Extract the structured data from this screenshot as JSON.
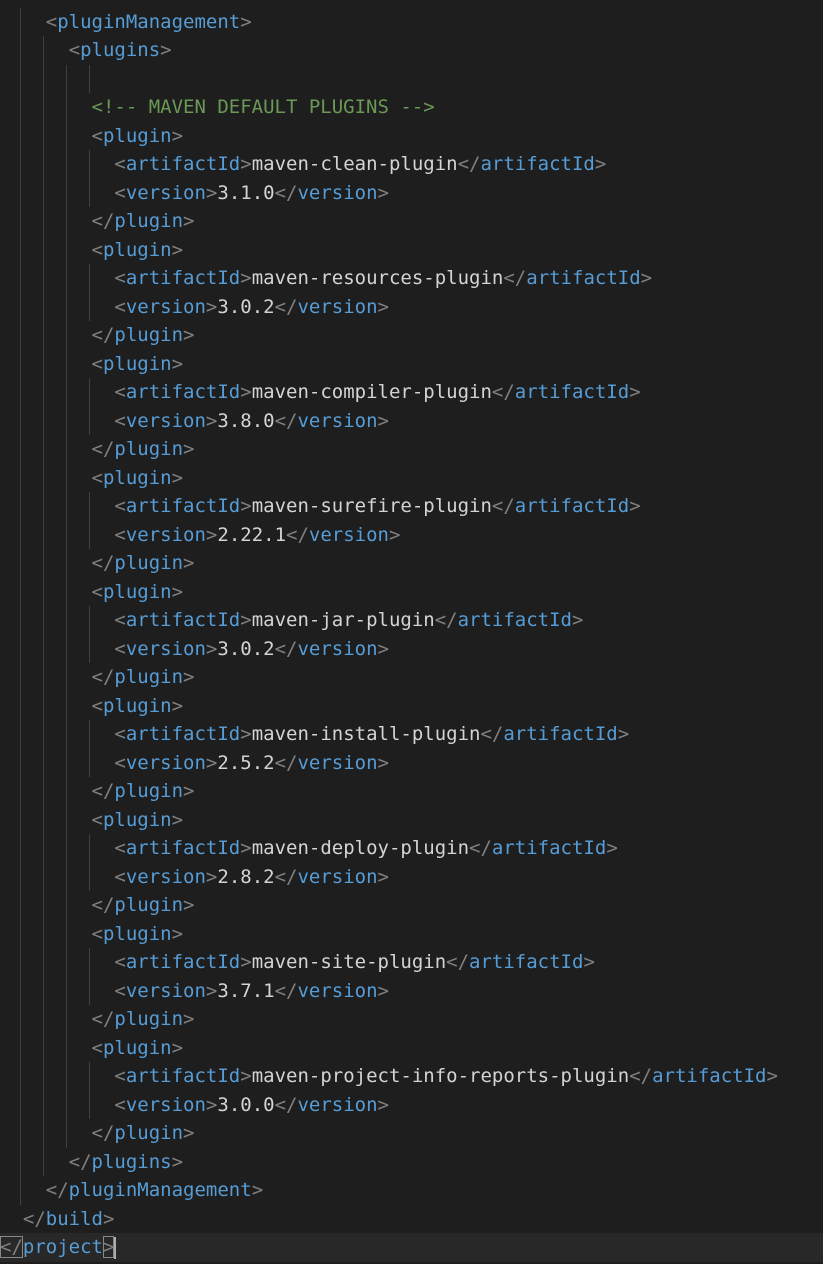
{
  "editor": {
    "language": "xml",
    "lines": [
      {
        "indent": 2,
        "kind": "open",
        "tag": "pluginManagement"
      },
      {
        "indent": 3,
        "kind": "open",
        "tag": "plugins"
      },
      {
        "indent": 0,
        "kind": "blank"
      },
      {
        "indent": 4,
        "kind": "comment",
        "text": "<!-- MAVEN DEFAULT PLUGINS -->"
      },
      {
        "indent": 4,
        "kind": "open",
        "tag": "plugin"
      },
      {
        "indent": 5,
        "kind": "element",
        "tag": "artifactId",
        "value": "maven-clean-plugin"
      },
      {
        "indent": 5,
        "kind": "element",
        "tag": "version",
        "value": "3.1.0"
      },
      {
        "indent": 4,
        "kind": "close",
        "tag": "plugin"
      },
      {
        "indent": 4,
        "kind": "open",
        "tag": "plugin"
      },
      {
        "indent": 5,
        "kind": "element",
        "tag": "artifactId",
        "value": "maven-resources-plugin"
      },
      {
        "indent": 5,
        "kind": "element",
        "tag": "version",
        "value": "3.0.2"
      },
      {
        "indent": 4,
        "kind": "close",
        "tag": "plugin"
      },
      {
        "indent": 4,
        "kind": "open",
        "tag": "plugin"
      },
      {
        "indent": 5,
        "kind": "element",
        "tag": "artifactId",
        "value": "maven-compiler-plugin"
      },
      {
        "indent": 5,
        "kind": "element",
        "tag": "version",
        "value": "3.8.0"
      },
      {
        "indent": 4,
        "kind": "close",
        "tag": "plugin"
      },
      {
        "indent": 4,
        "kind": "open",
        "tag": "plugin"
      },
      {
        "indent": 5,
        "kind": "element",
        "tag": "artifactId",
        "value": "maven-surefire-plugin"
      },
      {
        "indent": 5,
        "kind": "element",
        "tag": "version",
        "value": "2.22.1"
      },
      {
        "indent": 4,
        "kind": "close",
        "tag": "plugin"
      },
      {
        "indent": 4,
        "kind": "open",
        "tag": "plugin"
      },
      {
        "indent": 5,
        "kind": "element",
        "tag": "artifactId",
        "value": "maven-jar-plugin"
      },
      {
        "indent": 5,
        "kind": "element",
        "tag": "version",
        "value": "3.0.2"
      },
      {
        "indent": 4,
        "kind": "close",
        "tag": "plugin"
      },
      {
        "indent": 4,
        "kind": "open",
        "tag": "plugin"
      },
      {
        "indent": 5,
        "kind": "element",
        "tag": "artifactId",
        "value": "maven-install-plugin"
      },
      {
        "indent": 5,
        "kind": "element",
        "tag": "version",
        "value": "2.5.2"
      },
      {
        "indent": 4,
        "kind": "close",
        "tag": "plugin"
      },
      {
        "indent": 4,
        "kind": "open",
        "tag": "plugin"
      },
      {
        "indent": 5,
        "kind": "element",
        "tag": "artifactId",
        "value": "maven-deploy-plugin"
      },
      {
        "indent": 5,
        "kind": "element",
        "tag": "version",
        "value": "2.8.2"
      },
      {
        "indent": 4,
        "kind": "close",
        "tag": "plugin"
      },
      {
        "indent": 4,
        "kind": "open",
        "tag": "plugin"
      },
      {
        "indent": 5,
        "kind": "element",
        "tag": "artifactId",
        "value": "maven-site-plugin"
      },
      {
        "indent": 5,
        "kind": "element",
        "tag": "version",
        "value": "3.7.1"
      },
      {
        "indent": 4,
        "kind": "close",
        "tag": "plugin"
      },
      {
        "indent": 4,
        "kind": "open",
        "tag": "plugin"
      },
      {
        "indent": 5,
        "kind": "element",
        "tag": "artifactId",
        "value": "maven-project-info-reports-plugin"
      },
      {
        "indent": 5,
        "kind": "element",
        "tag": "version",
        "value": "3.0.0"
      },
      {
        "indent": 4,
        "kind": "close",
        "tag": "plugin"
      },
      {
        "indent": 3,
        "kind": "close",
        "tag": "plugins"
      },
      {
        "indent": 2,
        "kind": "close",
        "tag": "pluginManagement"
      },
      {
        "indent": 1,
        "kind": "close",
        "tag": "build"
      },
      {
        "indent": 0,
        "kind": "close",
        "tag": "project",
        "current": true
      }
    ]
  },
  "colors": {
    "background": "#1e1e1e",
    "bracket": "#808080",
    "tag": "#569cd6",
    "text": "#d4d4d4",
    "comment": "#6a9955",
    "indent_guide": "#404040",
    "current_line": "#282828"
  }
}
